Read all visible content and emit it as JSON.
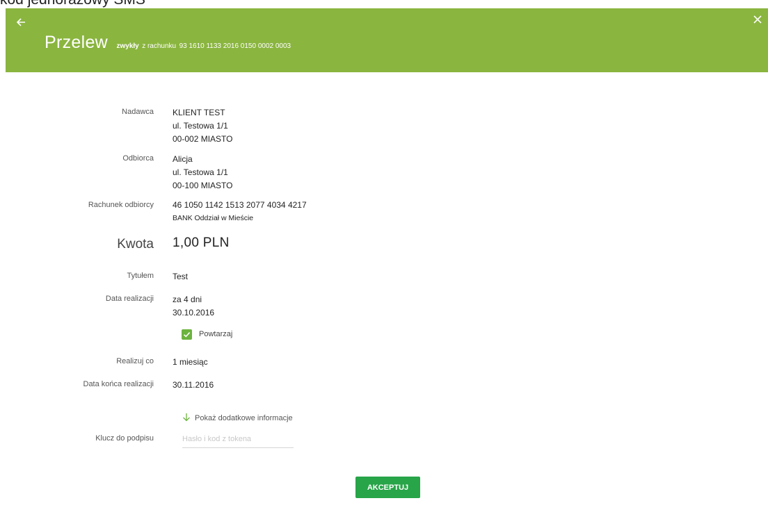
{
  "top_text": "kod jednorazowy SMS",
  "header": {
    "title": "Przelew",
    "type": "zwykły",
    "from_label": "z rachunku",
    "account": "93 1610 1133 2016 0150 0002 0003"
  },
  "sender": {
    "label": "Nadawca",
    "lines": [
      "KLIENT TEST",
      "ul. Testowa 1/1",
      "00-002 MIASTO"
    ]
  },
  "recipient": {
    "label": "Odbiorca",
    "lines": [
      "Alicja",
      "ul. Testowa 1/1",
      "00-100 MIASTO"
    ]
  },
  "recipient_account": {
    "label": "Rachunek odbiorcy",
    "number": "46 1050 1142 1513 2077 4034 4217",
    "bank": "BANK Oddział w Mieście"
  },
  "amount": {
    "label": "Kwota",
    "value": "1,00 PLN"
  },
  "title_field": {
    "label": "Tytułem",
    "value": "Test"
  },
  "execution_date": {
    "label": "Data realizacji",
    "relative": "za 4 dni",
    "date": "30.10.2016"
  },
  "repeat": {
    "label": "Powtarzaj",
    "checked": true
  },
  "frequency": {
    "label": "Realizuj co",
    "value": "1 miesiąc"
  },
  "end_date": {
    "label": "Data końca realizacji",
    "value": "30.11.2016"
  },
  "more_info": {
    "label": "Pokaż dodatkowe informacje"
  },
  "signature": {
    "label": "Klucz do podpisu",
    "placeholder": "Hasło i kod z tokena",
    "value": ""
  },
  "accept_button": {
    "label": "AKCEPTUJ"
  },
  "colors": {
    "header": "#8ab53f",
    "accept": "#27a548",
    "checkbox": "#6db33f"
  }
}
